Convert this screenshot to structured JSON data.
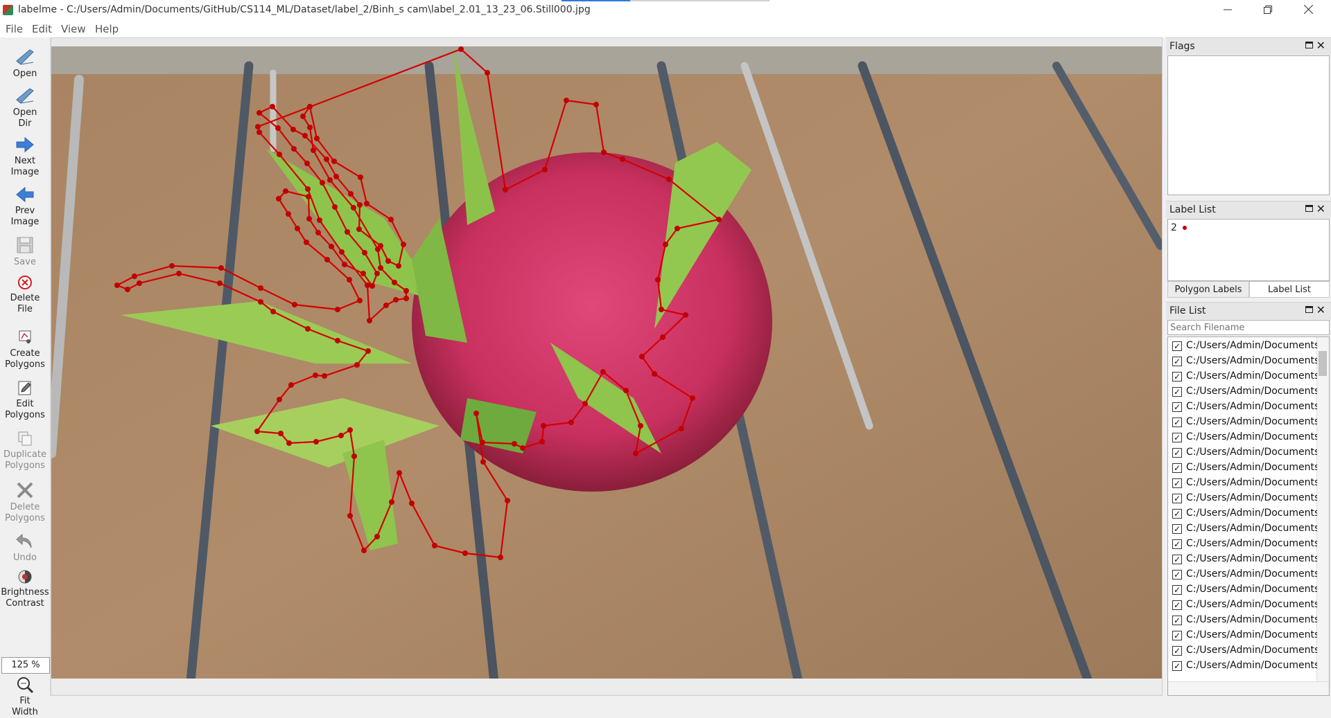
{
  "window": {
    "title": "labelme - C:/Users/Admin/Documents/GitHub/CS114_ML/Dataset/label_2/Binh_s cam\\label_2.01_13_23_06.Still000.jpg",
    "minimize_icon": "minimize-icon",
    "restore_icon": "restore-icon",
    "close_icon": "close-icon",
    "load_progress": 0.33
  },
  "menu": [
    "File",
    "Edit",
    "View",
    "Help"
  ],
  "toolbar": {
    "open": "Open",
    "open_dir": [
      "Open",
      "Dir"
    ],
    "next_image": [
      "Next",
      "Image"
    ],
    "prev_image": [
      "Prev",
      "Image"
    ],
    "save": "Save",
    "delete_file": [
      "Delete",
      "File"
    ],
    "create_polygons": [
      "Create",
      "Polygons"
    ],
    "edit_polygons": [
      "Edit",
      "Polygons"
    ],
    "duplicate_polygons": [
      "Duplicate",
      "Polygons"
    ],
    "delete_polygons": [
      "Delete",
      "Polygons"
    ],
    "undo": "Undo",
    "brightness_contrast": [
      "Brightness",
      "Contrast"
    ],
    "zoom": "125 %",
    "fit_width": [
      "Fit",
      "Width"
    ]
  },
  "canvas": {
    "annotation_label": "2",
    "polygon_color": "#d40000",
    "vertex_color": "#c00000"
  },
  "flags": {
    "title": "Flags"
  },
  "label_list": {
    "title": "Label List",
    "items": [
      {
        "label": "2",
        "color": "#c00000"
      }
    ],
    "tabs": [
      "Polygon Labels",
      "Label List"
    ],
    "active_tab": "Label List"
  },
  "file_list": {
    "title": "File List",
    "search_placeholder": "Search Filename",
    "visible_text": "C:/Users/Admin/Documents/",
    "rows": 22,
    "all_checked": true
  }
}
